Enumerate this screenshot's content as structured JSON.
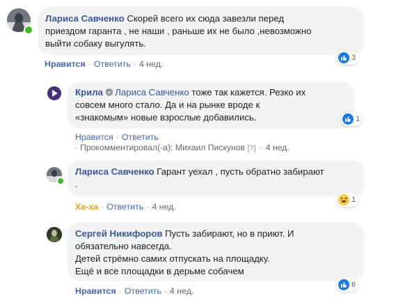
{
  "colors": {
    "link": "#385898",
    "action": "#4267b2",
    "bubble": "#f2f3f5",
    "like": "#1877f2",
    "online": "#42b72a"
  },
  "comments": [
    {
      "author": "Лариса Савченко",
      "text": "Скорей всего их сюда завезли перед\nприездом гаранта , не наши , раньше их не было ,невозможно\nвыйти собаку выгулять.",
      "reaction": {
        "icon": "like-icon",
        "count": "3"
      },
      "action_1": "Нравится",
      "action_2": "Ответить",
      "time": "4 нед."
    },
    {
      "author": "Крила",
      "mention": "Лариса Савченко",
      "text_line_1": " тоже так кажется. Резко их",
      "text_rest": "совсем много стало. Да и на рынке вроде к\n«знакомым» новые взрослые добавились.",
      "reaction": {
        "icon": "like-icon",
        "count": "1"
      },
      "action_1": "Нравится",
      "action_2": "Ответить",
      "commented_by": "Прокомментировал(-а): Михаил Пискунов",
      "help_mark": "[?]",
      "time": "4 нед."
    },
    {
      "author": "Лариса Савченко",
      "text": " Гарант уехал , пусть обратно забирают\n.",
      "reaction": {
        "icon": "haha-icon",
        "count": "1"
      },
      "action_1": "Ха-ха",
      "action_2": "Ответить",
      "time": "4 нед."
    },
    {
      "author": "Сергей Никифоров",
      "text": " Пусть забирают, но в приют. И\nобязательно навсегда.\nДетей стрёмно самих отпускать на площадку.\nЕщё и все площадки в дерьме собачем",
      "reaction": {
        "icon": "like-icon",
        "count": "6"
      },
      "action_1": "Нравится",
      "action_2": "Ответить",
      "time": "4 нед."
    }
  ],
  "sep": "·"
}
